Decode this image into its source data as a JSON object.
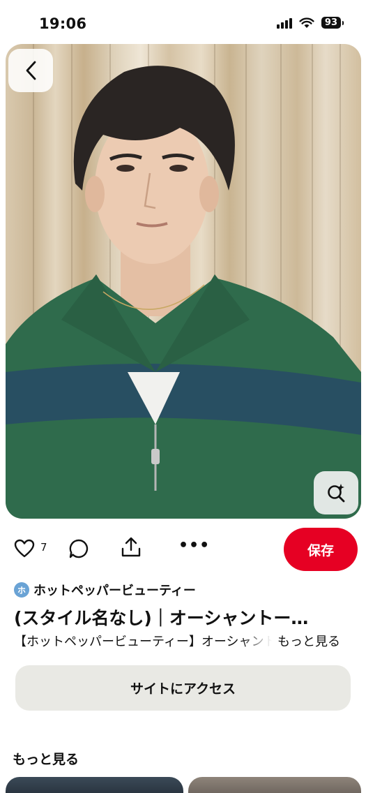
{
  "status_bar": {
    "time": "19:06",
    "battery": "93"
  },
  "pin": {
    "like_count": "7",
    "save_label": "保存",
    "source": {
      "avatar_letter": "ホ",
      "name": "ホットペッパービューティー"
    },
    "title": "(スタイル名なし)｜オーシャントー…",
    "description": "【ホットペッパービューティー】オーシャントーキョー",
    "more_label": "もっと見る",
    "visit_label": "サイトにアクセス"
  },
  "related": {
    "heading": "もっと見る"
  },
  "colors": {
    "save_button": "#e60023",
    "visit_button": "#e9e9e4",
    "sweater": "#2f6b4c"
  },
  "icons": [
    "back-chevron-icon",
    "visual-search-icon",
    "heart-icon",
    "comment-icon",
    "share-icon",
    "more-dots-icon"
  ]
}
